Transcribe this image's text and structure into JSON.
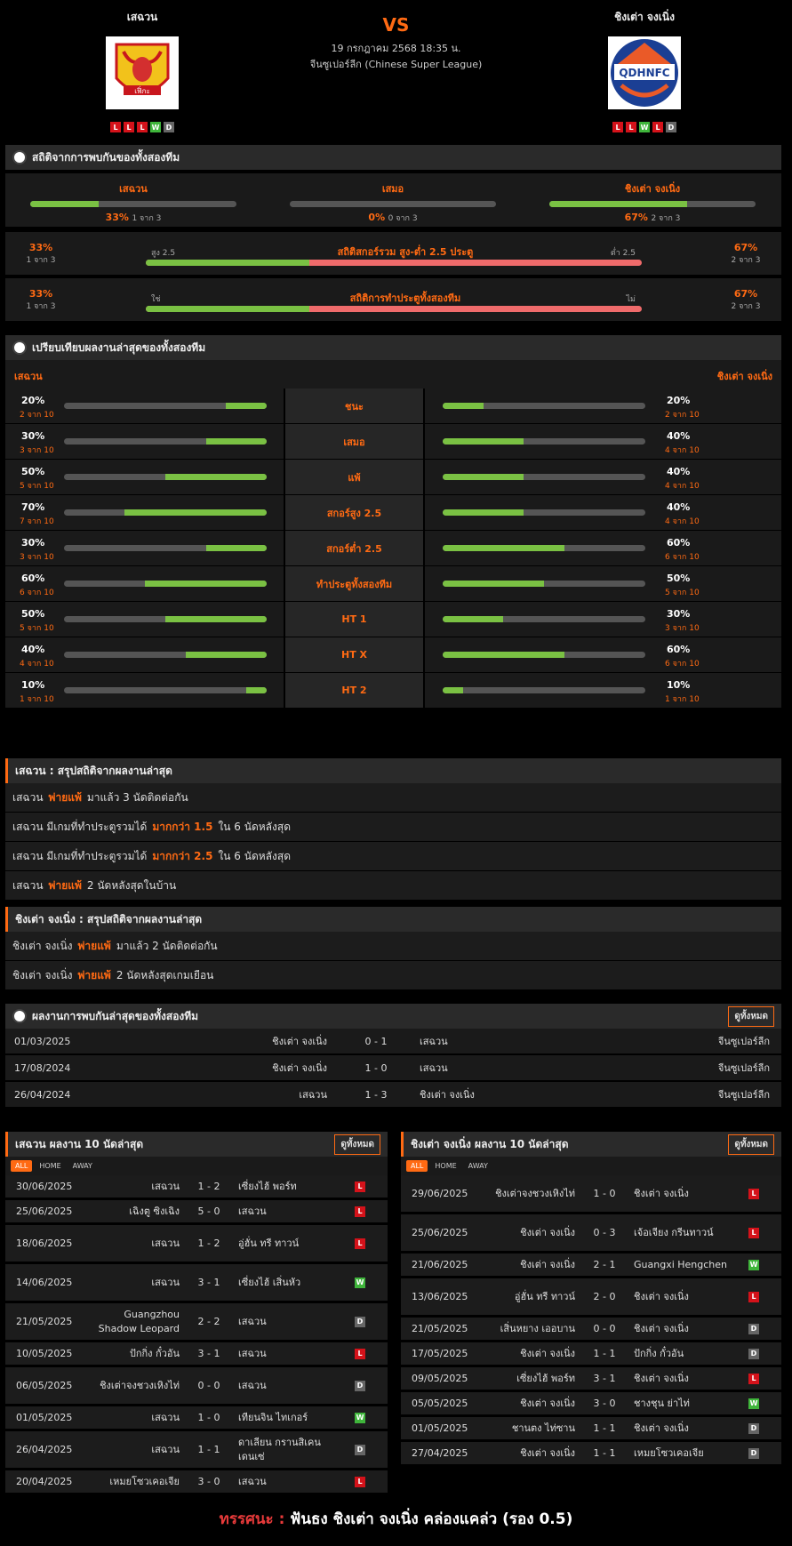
{
  "header": {
    "home_name": "เสฉวน",
    "away_name": "ชิงเต่า จงเนิ่ง",
    "vs": "VS",
    "date": "19 กรกฎาคม 2568 18:35 น.",
    "league": "จีนซูเปอร์ลีก (Chinese Super League)",
    "home_form": [
      "L",
      "L",
      "L",
      "W",
      "D"
    ],
    "away_form": [
      "L",
      "L",
      "W",
      "L",
      "D"
    ],
    "home_logo_text": "เฟิ่กะ",
    "away_logo_text": "QDHNFC"
  },
  "h2h_stats": {
    "title": "สถิติจากการพบกันของทั้งสองทีม",
    "home": {
      "label": "เสฉวน",
      "pct": "33%",
      "sub": "1 จาก 3",
      "value": 0.33
    },
    "draw": {
      "label": "เสมอ",
      "pct": "0%",
      "sub": "0 จาก 3",
      "value": 0
    },
    "away": {
      "label": "ชิงเต่า จงเนิ่ง",
      "pct": "67%",
      "sub": "2 จาก 3",
      "value": 0.67
    },
    "ou": {
      "title": "สถิติสกอร์รวม สูง-ต่ำ 2.5 ประตู",
      "left_pct": "33%",
      "left_sub": "1 จาก 3",
      "right_pct": "67%",
      "right_sub": "2 จาก 3",
      "left_label": "สูง 2.5",
      "right_label": "ต่ำ 2.5",
      "value": 0.33
    },
    "btts": {
      "title": "สถิติการทำประตูทั้งสองทีม",
      "left_pct": "33%",
      "left_sub": "1 จาก 3",
      "right_pct": "67%",
      "right_sub": "2 จาก 3",
      "left_label": "ใช่",
      "right_label": "ไม่",
      "value": 0.33
    }
  },
  "compare": {
    "title": "เปรียบเทียบผลงานล่าสุดของทั้งสองทีม",
    "home": "เสฉวน",
    "away": "ชิงเต่า จงเนิ่ง",
    "rows": [
      {
        "label": "ชนะ",
        "hp": "20%",
        "hs": "2 จาก 10",
        "hv": 0.2,
        "ap": "20%",
        "as": "2 จาก 10",
        "av": 0.2
      },
      {
        "label": "เสมอ",
        "hp": "30%",
        "hs": "3 จาก 10",
        "hv": 0.3,
        "ap": "40%",
        "as": "4 จาก 10",
        "av": 0.4
      },
      {
        "label": "แพ้",
        "hp": "50%",
        "hs": "5 จาก 10",
        "hv": 0.5,
        "ap": "40%",
        "as": "4 จาก 10",
        "av": 0.4
      },
      {
        "label": "สกอร์สูง 2.5",
        "hp": "70%",
        "hs": "7 จาก 10",
        "hv": 0.7,
        "ap": "40%",
        "as": "4 จาก 10",
        "av": 0.4
      },
      {
        "label": "สกอร์ต่ำ 2.5",
        "hp": "30%",
        "hs": "3 จาก 10",
        "hv": 0.3,
        "ap": "60%",
        "as": "6 จาก 10",
        "av": 0.6
      },
      {
        "label": "ทำประตูทั้งสองทีม",
        "hp": "60%",
        "hs": "6 จาก 10",
        "hv": 0.6,
        "ap": "50%",
        "as": "5 จาก 10",
        "av": 0.5
      },
      {
        "label": "HT 1",
        "hp": "50%",
        "hs": "5 จาก 10",
        "hv": 0.5,
        "ap": "30%",
        "as": "3 จาก 10",
        "av": 0.3
      },
      {
        "label": "HT X",
        "hp": "40%",
        "hs": "4 จาก 10",
        "hv": 0.4,
        "ap": "60%",
        "as": "6 จาก 10",
        "av": 0.6
      },
      {
        "label": "HT 2",
        "hp": "10%",
        "hs": "1 จาก 10",
        "hv": 0.1,
        "ap": "10%",
        "as": "1 จาก 10",
        "av": 0.1
      }
    ]
  },
  "home_summary": {
    "title": "เสฉวน : สรุปสถิติจากผลงานล่าสุด",
    "lines": [
      [
        "เสฉวน",
        "พ่ายแพ้",
        "มาแล้ว 3 นัดติดต่อกัน"
      ],
      [
        "เสฉวน มีเกมที่ทำประตูรวมได้",
        "มากกว่า 1.5",
        "ใน 6 นัดหลังสุด"
      ],
      [
        "เสฉวน มีเกมที่ทำประตูรวมได้",
        "มากกว่า 2.5",
        "ใน 6 นัดหลังสุด"
      ],
      [
        "เสฉวน",
        "พ่ายแพ้",
        "2 นัดหลังสุดในบ้าน"
      ]
    ]
  },
  "away_summary": {
    "title": "ชิงเต่า จงเนิ่ง : สรุปสถิติจากผลงานล่าสุด",
    "lines": [
      [
        "ชิงเต่า จงเนิ่ง",
        "พ่ายแพ้",
        "มาแล้ว 2 นัดติดต่อกัน"
      ],
      [
        "ชิงเต่า จงเนิ่ง",
        "พ่ายแพ้",
        "2 นัดหลังสุดเกมเยือน"
      ]
    ]
  },
  "h2h": {
    "title": "ผลงานการพบกันล่าสุดของทั้งสองทีม",
    "see_all": "ดูทั้งหมด",
    "rows": [
      [
        "01/03/2025",
        "ชิงเต่า จงเนิ่ง",
        "0 - 1",
        "เสฉวน",
        "จีนซูเปอร์ลีก"
      ],
      [
        "17/08/2024",
        "ชิงเต่า จงเนิ่ง",
        "1 - 0",
        "เสฉวน",
        "จีนซูเปอร์ลีก"
      ],
      [
        "26/04/2024",
        "เสฉวน",
        "1 - 3",
        "ชิงเต่า จงเนิ่ง",
        "จีนซูเปอร์ลีก"
      ]
    ]
  },
  "home_last": {
    "title": "เสฉวน ผลงาน 10 นัดล่าสุด",
    "see_all": "ดูทั้งหมด",
    "tabs": [
      "ALL",
      "HOME",
      "AWAY"
    ],
    "rows": [
      [
        "30/06/2025",
        "เสฉวน",
        "1 - 2",
        "เซี่ยงไฮ้ พอร์ท",
        "L"
      ],
      [
        "25/06/2025",
        "เฉิงตู ซิงเฉิง",
        "5 - 0",
        "เสฉวน",
        "L"
      ],
      [
        "18/06/2025",
        "เสฉวน",
        "1 - 2",
        "อู่ฮั่น ทรี ทาวน์",
        "L"
      ],
      [
        "14/06/2025",
        "เสฉวน",
        "3 - 1",
        "เซี่ยงไฮ้ เสิ่นหัว",
        "W"
      ],
      [
        "21/05/2025",
        "Guangzhou Shadow Leopard",
        "2 - 2",
        "เสฉวน",
        "D"
      ],
      [
        "10/05/2025",
        "ปักกิ่ง กั๋วอัน",
        "3 - 1",
        "เสฉวน",
        "L"
      ],
      [
        "06/05/2025",
        "ชิงเต่าจงชวงเหิงไท่",
        "0 - 0",
        "เสฉวน",
        "D"
      ],
      [
        "01/05/2025",
        "เสฉวน",
        "1 - 0",
        "เทียนจิน ไทเกอร์",
        "W"
      ],
      [
        "26/04/2025",
        "เสฉวน",
        "1 - 1",
        "ดาเลียน กรานสิเคน เดนเซ่",
        "D"
      ],
      [
        "20/04/2025",
        "เหมยโซวเคอเจีย",
        "3 - 0",
        "เสฉวน",
        "L"
      ]
    ]
  },
  "away_last": {
    "title": "ชิงเต่า จงเนิ่ง ผลงาน 10 นัดล่าสุด",
    "see_all": "ดูทั้งหมด",
    "tabs": [
      "ALL",
      "HOME",
      "AWAY"
    ],
    "rows": [
      [
        "29/06/2025",
        "ชิงเต่าจงชวงเหิงไท่",
        "1 - 0",
        "ชิงเต่า จงเนิ่ง",
        "L"
      ],
      [
        "25/06/2025",
        "ชิงเต่า จงเนิ่ง",
        "0 - 3",
        "เจ้อเจียง กรีนทาวน์",
        "L"
      ],
      [
        "21/06/2025",
        "ชิงเต่า จงเนิ่ง",
        "2 - 1",
        "Guangxi Hengchen",
        "W"
      ],
      [
        "13/06/2025",
        "อู่ฮั่น ทรี ทาวน์",
        "2 - 0",
        "ชิงเต่า จงเนิ่ง",
        "L"
      ],
      [
        "21/05/2025",
        "เสิ่นหยาง เออบาน",
        "0 - 0",
        "ชิงเต่า จงเนิ่ง",
        "D"
      ],
      [
        "17/05/2025",
        "ชิงเต่า จงเนิ่ง",
        "1 - 1",
        "ปักกิ่ง กั๋วอัน",
        "D"
      ],
      [
        "09/05/2025",
        "เซี่ยงไฮ้ พอร์ท",
        "3 - 1",
        "ชิงเต่า จงเนิ่ง",
        "L"
      ],
      [
        "05/05/2025",
        "ชิงเต่า จงเนิ่ง",
        "3 - 0",
        "ชางชุน ย่าไท่",
        "W"
      ],
      [
        "01/05/2025",
        "ชานตง ไท่ซาน",
        "1 - 1",
        "ชิงเต่า จงเนิ่ง",
        "D"
      ],
      [
        "27/04/2025",
        "ชิงเต่า จงเนิ่ง",
        "1 - 1",
        "เหมยโซวเคอเจีย",
        "D"
      ]
    ]
  },
  "verdict": {
    "label": "ทรรศนะ :",
    "text": "ฟันธง ชิงเต่า จงเนิ่ง คล่องแคล่ว (รอง 0.5)"
  }
}
